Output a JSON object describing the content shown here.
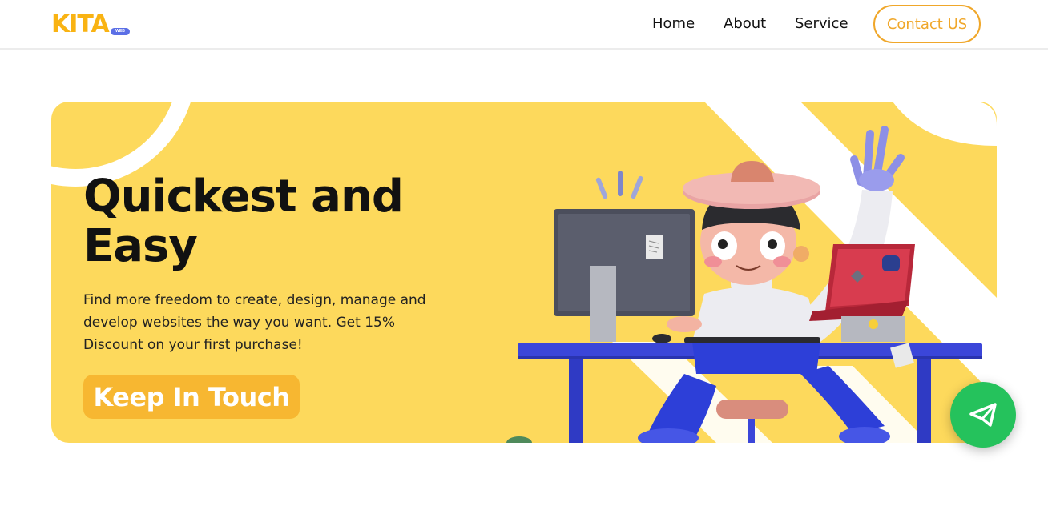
{
  "brand": {
    "name": "KITA",
    "badge": "WEB",
    "color": "#f9b313"
  },
  "nav": {
    "items": [
      {
        "label": "Home"
      },
      {
        "label": "About"
      },
      {
        "label": "Service"
      }
    ],
    "contact_label": "Contact US"
  },
  "hero": {
    "title_line1": "Quickest and",
    "title_line2": "Easy",
    "description": "Find more freedom to create, design, manage and develop websites the way you want. Get 15% Discount on your first purchase!",
    "cta_label": "Keep In Touch",
    "background_color": "#fdd95c",
    "cta_color": "#f7b731"
  },
  "floating_button": {
    "icon": "telegram-icon",
    "color": "#25c25c"
  },
  "illustration": {
    "icon": "person-at-desk-illustration"
  }
}
